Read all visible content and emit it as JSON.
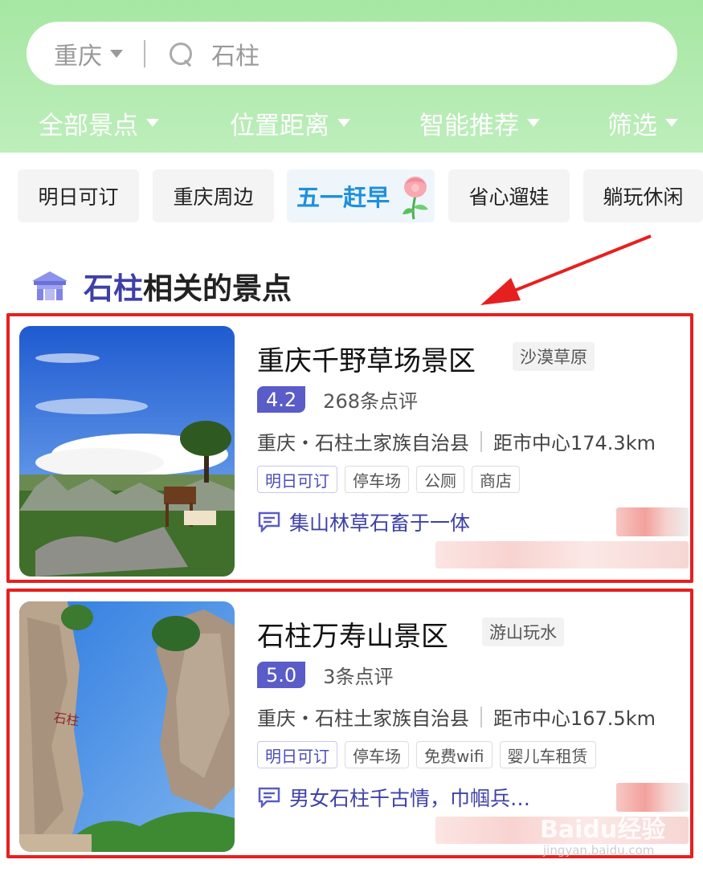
{
  "search": {
    "city": "重庆",
    "query": "石柱"
  },
  "filters": [
    {
      "label": "全部景点"
    },
    {
      "label": "位置距离"
    },
    {
      "label": "智能推荐"
    },
    {
      "label": "筛选"
    }
  ],
  "chips": [
    {
      "label": "明日可订"
    },
    {
      "label": "重庆周边"
    },
    {
      "label": "五一赶早"
    },
    {
      "label": "省心遛娃"
    },
    {
      "label": "躺玩休闲"
    }
  ],
  "section": {
    "highlight": "石柱",
    "rest": "相关的景点"
  },
  "results": [
    {
      "name": "重庆千野草场景区",
      "type_tag": "沙漠草原",
      "rating": "4.2",
      "reviews": "268条点评",
      "location": "重庆・石柱土家族自治县",
      "distance": "距市中心174.3km",
      "tags": [
        "明日可订",
        "停车场",
        "公厕",
        "商店"
      ],
      "comment": "集山林草石畜于一体"
    },
    {
      "name": "石柱万寿山景区",
      "type_tag": "游山玩水",
      "rating": "5.0",
      "reviews": "3条点评",
      "location": "重庆・石柱土家族自治县",
      "distance": "距市中心167.5km",
      "tags": [
        "明日可订",
        "停车场",
        "免费wifi",
        "婴儿车租赁"
      ],
      "comment": "男女石柱千古情，巾帼兵…"
    }
  ],
  "watermark": {
    "brand": "Baidu经验",
    "url": "jingyan.baidu.com"
  },
  "colors": {
    "header_green": "#a6e7a3",
    "accent_purple": "#5a5cc7",
    "annotation_red": "#e62020"
  }
}
